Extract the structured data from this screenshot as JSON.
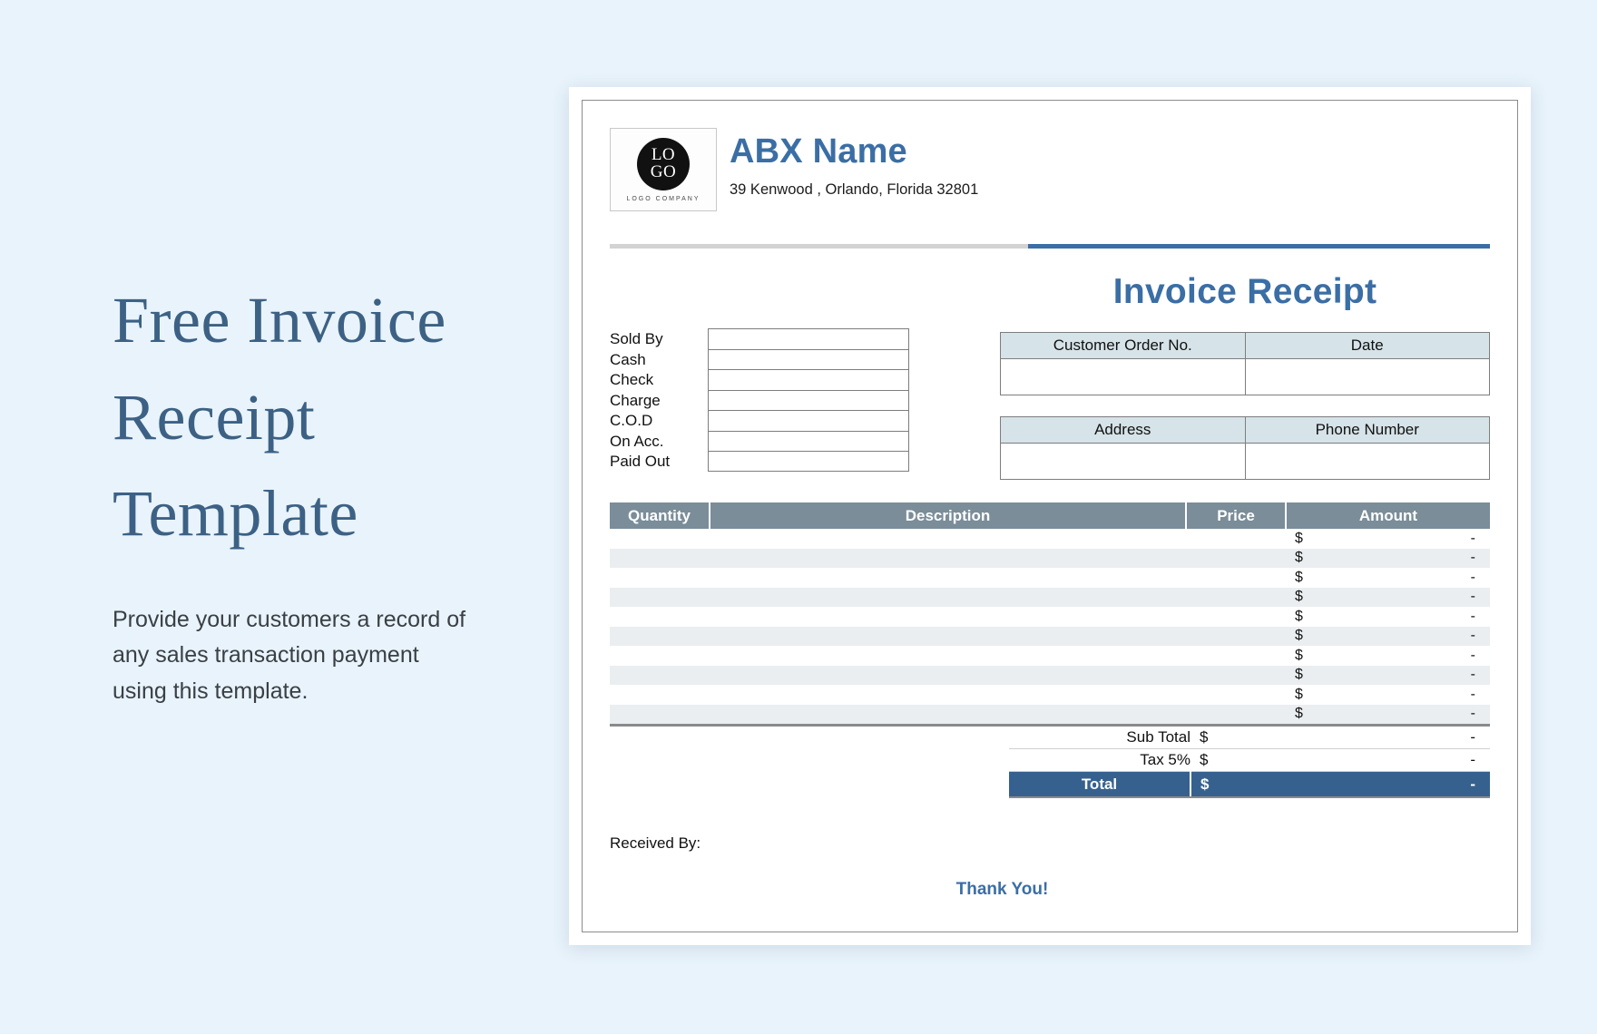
{
  "promo": {
    "title": "Free Invoice\nReceipt\nTemplate",
    "subtitle": "Provide your customers a record of\nany sales transaction payment\nusing this template."
  },
  "document": {
    "logo": {
      "line1": "LO",
      "line2": "GO",
      "caption": "LOGO COMPANY"
    },
    "company_name": "ABX Name",
    "company_address": "39 Kenwood , Orlando, Florida 32801",
    "invoice_title": "Invoice Receipt",
    "sold_by_labels": [
      "Sold By",
      "Cash",
      "Check",
      "Charge",
      "C.O.D",
      "On Acc.",
      "Paid Out"
    ],
    "order_table": {
      "headers": [
        "Customer Order No.",
        "Date"
      ],
      "values": [
        "",
        ""
      ]
    },
    "contact_table": {
      "headers": [
        "Address",
        "Phone Number"
      ],
      "values": [
        "",
        ""
      ]
    },
    "items_table": {
      "headers": [
        "Quantity",
        "Description",
        "Price",
        "Amount"
      ],
      "currency_symbol": "$",
      "empty_value": "-",
      "rows": [
        {
          "quantity": "",
          "description": "",
          "price": "",
          "amount": "-"
        },
        {
          "quantity": "",
          "description": "",
          "price": "",
          "amount": "-"
        },
        {
          "quantity": "",
          "description": "",
          "price": "",
          "amount": "-"
        },
        {
          "quantity": "",
          "description": "",
          "price": "",
          "amount": "-"
        },
        {
          "quantity": "",
          "description": "",
          "price": "",
          "amount": "-"
        },
        {
          "quantity": "",
          "description": "",
          "price": "",
          "amount": "-"
        },
        {
          "quantity": "",
          "description": "",
          "price": "",
          "amount": "-"
        },
        {
          "quantity": "",
          "description": "",
          "price": "",
          "amount": "-"
        },
        {
          "quantity": "",
          "description": "",
          "price": "",
          "amount": "-"
        },
        {
          "quantity": "",
          "description": "",
          "price": "",
          "amount": "-"
        }
      ]
    },
    "totals": {
      "sub_total_label": "Sub Total",
      "sub_total_currency": "$",
      "sub_total_value": "-",
      "tax_label": "Tax 5%",
      "tax_currency": "$",
      "tax_value": "-",
      "total_label": "Total",
      "total_currency": "$",
      "total_value": "-"
    },
    "received_by_label": "Received By:",
    "thank_you": "Thank You!"
  },
  "colors": {
    "page_background": "#e8f3fb",
    "brand_blue": "#3b6ea5",
    "heading_blue": "#3c6184",
    "table_header_slate": "#7a8d99",
    "info_header_blue": "#d6e3e8",
    "total_bar_blue": "#36618f",
    "row_stripe": "#eaeef1"
  }
}
